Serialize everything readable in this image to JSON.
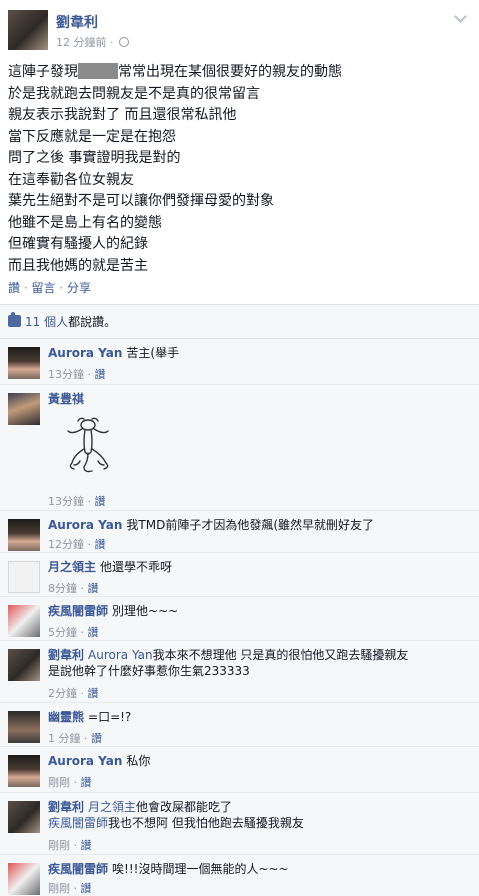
{
  "post": {
    "author": "劉韋利",
    "time": "12 分鐘前",
    "meta_sep": "·",
    "lines": [
      {
        "before": "這陣子發現",
        "after": "常常出現在某個很要好的親友的動態"
      },
      {
        "text": "於是我就跑去問親友是不是真的很常留言"
      },
      {
        "text": "親友表示我說對了 而且還很常私訊他"
      },
      {
        "text": "當下反應就是一定是在抱怨"
      },
      {
        "text": "問了之後 事實證明我是對的"
      },
      {
        "text": "在這奉勸各位女親友"
      },
      {
        "text": "葉先生絕對不是可以讓你們發揮母愛的對象"
      },
      {
        "text": "他雖不是島上有名的變態"
      },
      {
        "text": "但確實有騷擾人的紀錄"
      },
      {
        "text": "而且我他媽的就是苦主"
      }
    ],
    "actions": {
      "like": "讚",
      "comment": "留言",
      "share": "分享",
      "sep": "·"
    }
  },
  "likes": {
    "count_link": "11 個人",
    "suffix": "都說讚。"
  },
  "comments": [
    {
      "name": "Aurora Yan",
      "text": "苦主(舉手",
      "time": "13分鐘",
      "like": "讚"
    },
    {
      "name": "黃豊祺",
      "text": "",
      "time": "13分鐘",
      "like": "讚"
    },
    {
      "name": "Aurora Yan",
      "text": "我TMD前陣子才因為他發飆(雖然早就刪好友了",
      "time": "12分鐘",
      "like": "讚"
    },
    {
      "name": "月之領主",
      "text": "他還學不乖呀",
      "time": "8分鐘",
      "like": "讚"
    },
    {
      "name": "疾風闇雷師",
      "text": "別理他~~~",
      "time": "5分鐘",
      "like": "讚"
    },
    {
      "name": "劉韋利",
      "mention": "Aurora Yan",
      "text": "我本來不想理他 只是真的很怕他又跑去騷擾親友",
      "text2": "是說他幹了什麼好事惹你生氣233333",
      "time": "2分鐘",
      "like": "讚"
    },
    {
      "name": "幽靈熊",
      "text": "=口=!?",
      "time": "1 分鐘",
      "like": "讚"
    },
    {
      "name": "Aurora Yan",
      "text": "私你",
      "time": "剛剛",
      "like": "讚"
    },
    {
      "name": "劉韋利",
      "mention": "月之領主",
      "text": "他會改屎都能吃了",
      "mention2": "疾風闇雷師",
      "text2": "我也不想阿 但我怕他跑去騷擾我親友",
      "time": "剛剛",
      "like": "讚"
    },
    {
      "name": "疾風闇雷師",
      "text": "唉!!!沒時間理一個無能的人~~~",
      "time": "剛剛",
      "like": "讚"
    }
  ],
  "colors": {
    "link": "#3b5998",
    "meta": "#9197a3",
    "feedback_bg": "#f6f7f9"
  },
  "icons": [
    "globe-icon",
    "chevron-down-icon",
    "thumb-up-icon"
  ]
}
